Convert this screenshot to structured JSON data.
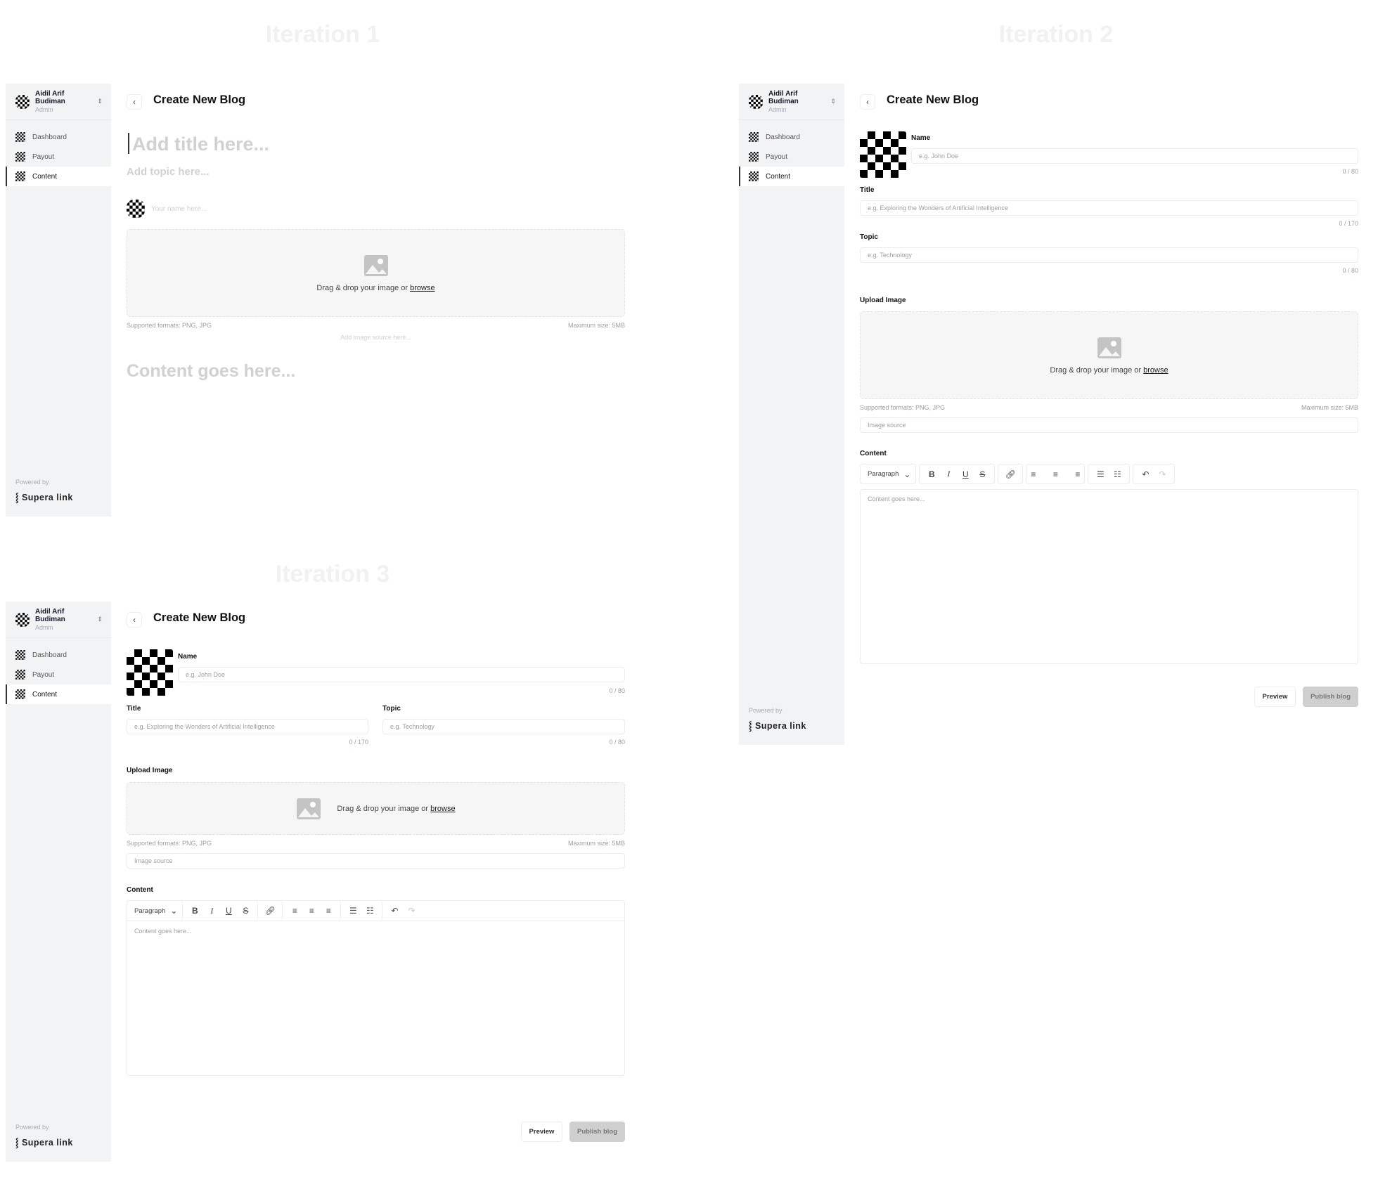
{
  "iterations": [
    "Iteration 1",
    "Iteration 2",
    "Iteration 3"
  ],
  "sidebar": {
    "user_name": "Aidil Arif Budiman",
    "user_role": "Admin",
    "nav": [
      "Dashboard",
      "Payout",
      "Content"
    ],
    "active": "Content",
    "powered_by": "Powered by",
    "brand": "Supera link"
  },
  "header": {
    "back": "‹",
    "title": "Create New Blog"
  },
  "iteration1": {
    "title_placeholder": "Add title here...",
    "topic_placeholder": "Add topic here...",
    "name_placeholder": "Your name here...",
    "image_source_placeholder": "Add image source here...",
    "content_placeholder": "Content goes here..."
  },
  "upload": {
    "drop_text": "Drag & drop your image or",
    "browse": "browse",
    "formats": "Supported formats: PNG, JPG",
    "max_size": "Maximum size: 5MB"
  },
  "form": {
    "name_label": "Name",
    "name_placeholder": "e.g. John Doe",
    "name_counter": "0 / 80",
    "title_label": "Title",
    "title_placeholder": "e.g. Exploring the Wonders of Artificial Intelligence",
    "title_counter": "0 / 170",
    "topic_label": "Topic",
    "topic_placeholder": "e.g. Technology",
    "topic_counter": "0 / 80",
    "upload_label": "Upload Image",
    "image_source_placeholder": "Image source",
    "content_label": "Content",
    "content_placeholder": "Content goes here...",
    "paragraph": "Paragraph",
    "preview": "Preview",
    "publish": "Publish blog"
  },
  "toolbar": {
    "chevron": "⌄",
    "bold": "B",
    "italic": "I",
    "underline": "U",
    "strike": "S",
    "link": "🔗︎",
    "align_left": "≡",
    "align_center": "≡",
    "align_right": "≡",
    "bullets": "☰",
    "numbers": "☷",
    "undo": "↶",
    "redo": "↷"
  },
  "colors": {
    "sidebar_bg": "#f2f3f5",
    "publish_disabled": "#cfcfcf",
    "active_border": "#333333"
  }
}
